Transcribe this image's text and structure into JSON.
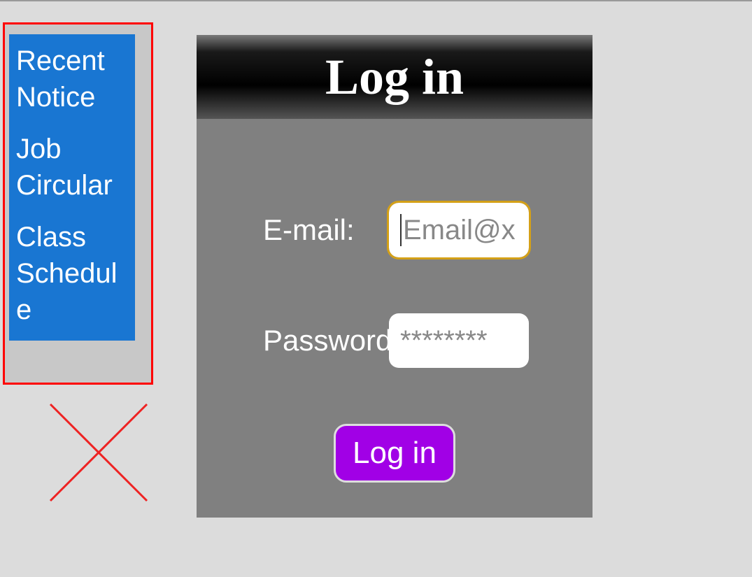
{
  "sidebar": {
    "items": [
      {
        "label": "Recent Notice"
      },
      {
        "label": "Job Circular"
      },
      {
        "label": "Class Schedule"
      }
    ]
  },
  "login": {
    "heading": "Log in",
    "email_label": "E-mail:",
    "email_placeholder": "Email@x",
    "password_label": "Password:",
    "password_masked": "********",
    "button_label": "Log in"
  }
}
